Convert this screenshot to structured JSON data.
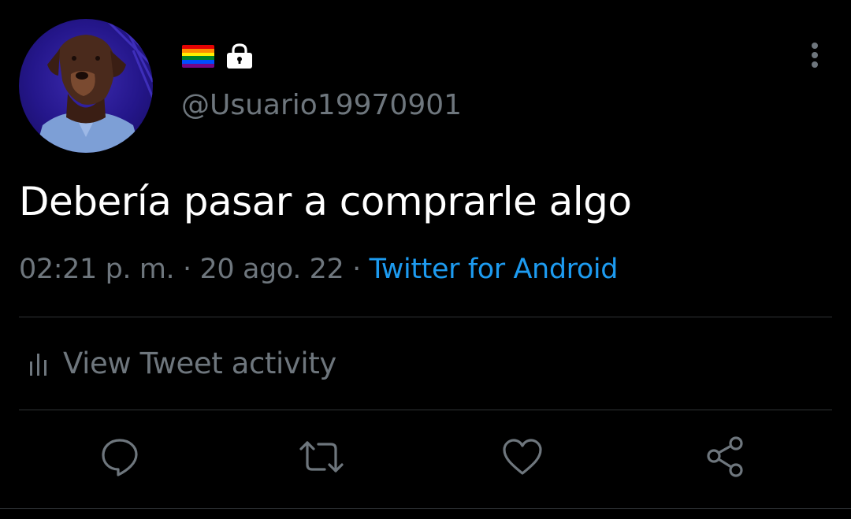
{
  "profile": {
    "handle": "@Usuario19970901",
    "flag_colors": [
      "#e40303",
      "#ff8c00",
      "#ffed00",
      "#008026",
      "#004dff",
      "#750787"
    ]
  },
  "tweet": {
    "text": "Debería pasar a comprarle algo",
    "time": "02:21 p. m.",
    "separator": "·",
    "date": "20 ago. 22",
    "source": "Twitter for Android"
  },
  "activity": {
    "label": "View Tweet activity"
  },
  "icons": [
    "more-vertical-icon",
    "lock-icon",
    "bar-chart-icon",
    "reply-icon",
    "retweet-icon",
    "like-icon",
    "share-icon"
  ],
  "colors": {
    "background": "#000000",
    "text": "#ffffff",
    "muted": "#6e767d",
    "accent": "#1d9bf0",
    "divider": "#2f3336"
  }
}
